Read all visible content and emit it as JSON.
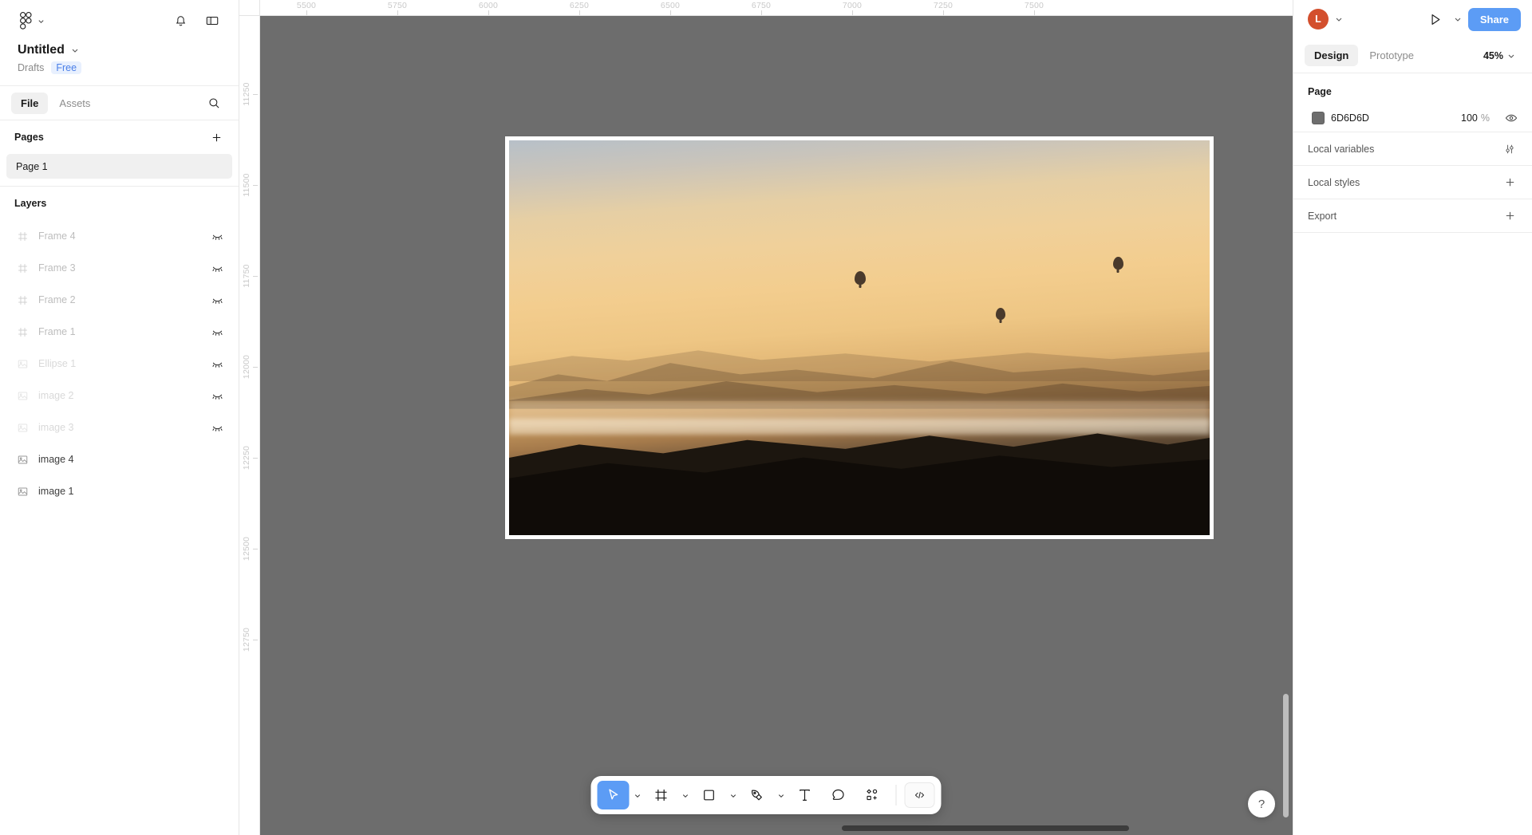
{
  "app": {
    "name": "Figma"
  },
  "left_panel": {
    "logo_icon": "figma-logo-icon",
    "logo_caret": "chevron-down-icon",
    "notifications_icon": "bell-icon",
    "panel_toggle_icon": "sidebar-toggle-icon",
    "file_title": "Untitled",
    "file_title_caret": "chevron-down-icon",
    "drafts_label": "Drafts",
    "plan_label": "Free",
    "tabs": [
      {
        "label": "File",
        "active": true
      },
      {
        "label": "Assets",
        "active": false
      }
    ],
    "search_icon": "search-icon",
    "pages": {
      "title": "Pages",
      "add_icon": "plus-icon",
      "items": [
        {
          "label": "Page 1",
          "selected": true
        }
      ]
    },
    "layers": {
      "title": "Layers",
      "items": [
        {
          "label": "Frame 4",
          "icon": "frame-icon",
          "visibility_icon": "eye-closed-icon",
          "state": "hidden"
        },
        {
          "label": "Frame 3",
          "icon": "frame-icon",
          "visibility_icon": "eye-closed-icon",
          "state": "hidden"
        },
        {
          "label": "Frame 2",
          "icon": "frame-icon",
          "visibility_icon": "eye-closed-icon",
          "state": "hidden"
        },
        {
          "label": "Frame 1",
          "icon": "frame-icon",
          "visibility_icon": "eye-closed-icon",
          "state": "hidden"
        },
        {
          "label": "Ellipse 1",
          "icon": "image-icon",
          "visibility_icon": "eye-closed-icon",
          "state": "faded"
        },
        {
          "label": "image 2",
          "icon": "image-icon",
          "visibility_icon": "eye-closed-icon",
          "state": "faded"
        },
        {
          "label": "image 3",
          "icon": "image-icon",
          "visibility_icon": "eye-closed-icon",
          "state": "faded"
        },
        {
          "label": "image 4",
          "icon": "image-icon",
          "visibility_icon": "",
          "state": "visible"
        },
        {
          "label": "image 1",
          "icon": "image-icon",
          "visibility_icon": "",
          "state": "visible"
        }
      ]
    }
  },
  "canvas": {
    "background_color": "#6D6D6D",
    "ruler_horizontal": [
      "5500",
      "5750",
      "6000",
      "6250",
      "6500",
      "6750",
      "7000",
      "7250",
      "7500"
    ],
    "ruler_vertical": [
      "11250",
      "11500",
      "11750",
      "12000",
      "12250",
      "12500",
      "12750"
    ],
    "artboard": {
      "name": "image-artboard",
      "description": "Desert sunrise landscape with hot air balloons over misty dunes"
    },
    "scrollbar_vertical": "vertical-scrollbar",
    "scrollbar_horizontal": "horizontal-scrollbar"
  },
  "toolbar": {
    "tools": [
      {
        "name": "move-tool",
        "icon": "cursor-icon",
        "active": true,
        "has_caret": true
      },
      {
        "name": "frame-tool",
        "icon": "frame-icon",
        "active": false,
        "has_caret": true
      },
      {
        "name": "shape-tool",
        "icon": "rectangle-icon",
        "active": false,
        "has_caret": true
      },
      {
        "name": "pen-tool",
        "icon": "pen-icon",
        "active": false,
        "has_caret": true
      },
      {
        "name": "text-tool",
        "icon": "text-icon",
        "active": false,
        "has_caret": false
      },
      {
        "name": "comment-tool",
        "icon": "comment-icon",
        "active": false,
        "has_caret": false
      },
      {
        "name": "actions-tool",
        "icon": "components-icon",
        "active": false,
        "has_caret": false
      }
    ],
    "dev_mode": {
      "name": "dev-mode-toggle",
      "icon": "code-icon"
    },
    "caret_icon": "chevron-down-icon"
  },
  "help": {
    "label": "?",
    "icon": "help-icon"
  },
  "right_panel": {
    "avatar_initial": "L",
    "avatar_color": "#D34F2D",
    "avatar_caret": "chevron-down-icon",
    "present_icon": "play-icon",
    "present_caret": "chevron-down-icon",
    "share_label": "Share",
    "share_color": "#5C9CF5",
    "tabs": [
      {
        "label": "Design",
        "active": true
      },
      {
        "label": "Prototype",
        "active": false
      }
    ],
    "zoom_level": "45%",
    "zoom_caret": "chevron-down-icon",
    "page_section": {
      "title": "Page",
      "fill_hex": "6D6D6D",
      "fill_color": "#6D6D6D",
      "opacity": "100",
      "opacity_unit": "%",
      "visibility_icon": "eye-open-icon"
    },
    "rows": [
      {
        "label": "Local variables",
        "action_icon": "sliders-icon"
      },
      {
        "label": "Local styles",
        "action_icon": "plus-icon"
      },
      {
        "label": "Export",
        "action_icon": "plus-icon"
      }
    ]
  }
}
